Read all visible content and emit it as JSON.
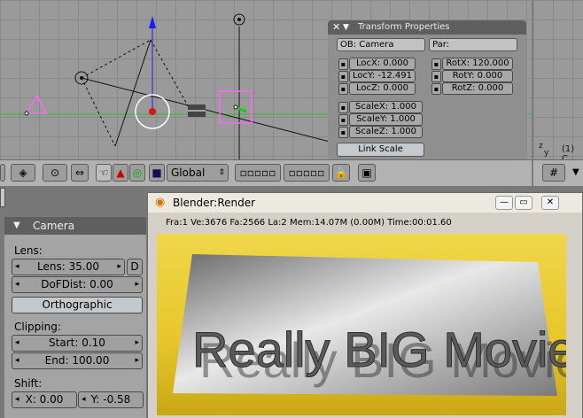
{
  "viewport": {
    "view_label": "(1) C",
    "axis_y": "y",
    "axis_z": "z"
  },
  "transform": {
    "title": "Transform Properties",
    "ob_field": "OB: Camera",
    "par_field": "Par:",
    "locx": "LocX: 0.000",
    "locy": "LocY: -12.491",
    "locz": "LocZ: 0.000",
    "rotx": "RotX: 120.000",
    "roty": "RotY: 0.000",
    "rotz": "RotZ: 0.000",
    "scalex": "ScaleX: 1.000",
    "scaley": "ScaleY: 1.000",
    "scalez": "ScaleZ: 1.000",
    "link_scale": "Link Scale"
  },
  "header": {
    "orientation": "Global"
  },
  "camera": {
    "title": "Camera",
    "lens_label": "Lens:",
    "lens_value": "Lens: 35.00",
    "d_button": "D",
    "dofdist": "DoFDist: 0.00",
    "orthographic": "Orthographic",
    "clipping_label": "Clipping:",
    "clip_start": "Start: 0.10",
    "clip_end": "End: 100.00",
    "shift_label": "Shift:",
    "shift_x": "X: 0.00",
    "shift_y": "Y: -0.58"
  },
  "render_window": {
    "title": "Blender:Render",
    "stats": "Fra:1  Ve:3676 Fa:2566 La:2 Mem:14.07M (0.00M) Time:00:01.60",
    "render_text": "Really BIG Movie"
  },
  "colors": {
    "accent_green": "#22b022",
    "selected_pink": "#ff66ff",
    "render_bg": "#e6c62a"
  }
}
